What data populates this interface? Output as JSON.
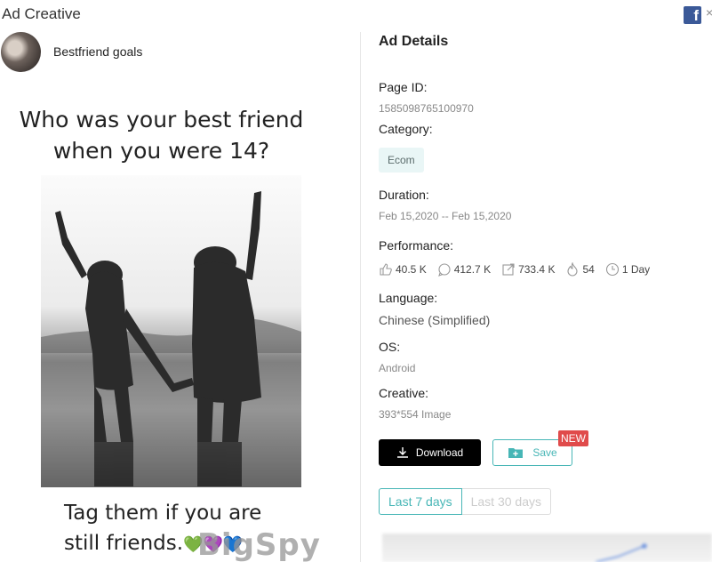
{
  "header": {
    "title": "Ad Creative",
    "fb_icon_glyph": "f",
    "close_glyph": "×"
  },
  "advertiser": {
    "name": "Bestfriend goals"
  },
  "creative": {
    "top_line_1": "Who was your best friend",
    "top_line_2": "when you were 14?",
    "bottom_line_1": "Tag them if you are",
    "bottom_line_2": "still friends.",
    "emoji": "💚💜💙",
    "watermark": "BigSpy"
  },
  "details": {
    "section_title": "Ad Details",
    "page_id_label": "Page ID:",
    "page_id": "1585098765100970",
    "category_label": "Category:",
    "category": "Ecom",
    "duration_label": "Duration:",
    "duration": "Feb 15,2020 -- Feb 15,2020",
    "performance_label": "Performance:",
    "performance": {
      "likes": "40.5 K",
      "comments": "412.7 K",
      "shares": "733.4 K",
      "hot": "54",
      "days": "1 Day"
    },
    "language_label": "Language:",
    "language": "Chinese (Simplified)",
    "os_label": "OS:",
    "os": "Android",
    "creative_label": "Creative:",
    "creative_info": "393*554 Image"
  },
  "actions": {
    "download_label": "Download",
    "save_label": "Save",
    "new_badge": "NEW"
  },
  "tabs": [
    {
      "label": "Last 7 days",
      "active": true
    },
    {
      "label": "Last 30 days",
      "active": false
    }
  ],
  "colors": {
    "accent": "#47b6b6",
    "badge": "#e04b4b",
    "facebook": "#3b5998"
  }
}
